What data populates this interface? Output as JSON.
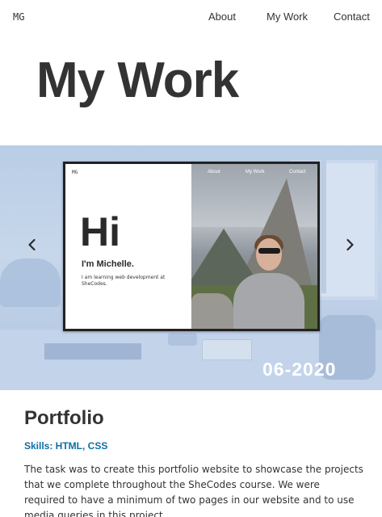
{
  "nav": {
    "brand": "MG",
    "items": [
      {
        "label": "About"
      },
      {
        "label": "My Work"
      },
      {
        "label": "Contact"
      }
    ]
  },
  "page": {
    "title": "My Work"
  },
  "carousel": {
    "date": "06-2020",
    "preview": {
      "brand": "MG",
      "nav": [
        "About",
        "My Work",
        "Contact"
      ],
      "heading": "Hi",
      "name": "I'm Michelle.",
      "description": "I am learning web development at SheCodes."
    },
    "prev_icon": "chevron-left-icon",
    "next_icon": "chevron-right-icon"
  },
  "project": {
    "title": "Portfolio",
    "skills": "Skills: HTML, CSS",
    "description": "The task was to create this portfolio website to showcase the projects that we complete throughout the SheCodes course. We were required to have a minimum of two pages in our website and to use media queries in this project."
  },
  "colors": {
    "accent_link": "#0c6fa8",
    "text": "#333333",
    "hero_overlay": "#b9cde6"
  }
}
